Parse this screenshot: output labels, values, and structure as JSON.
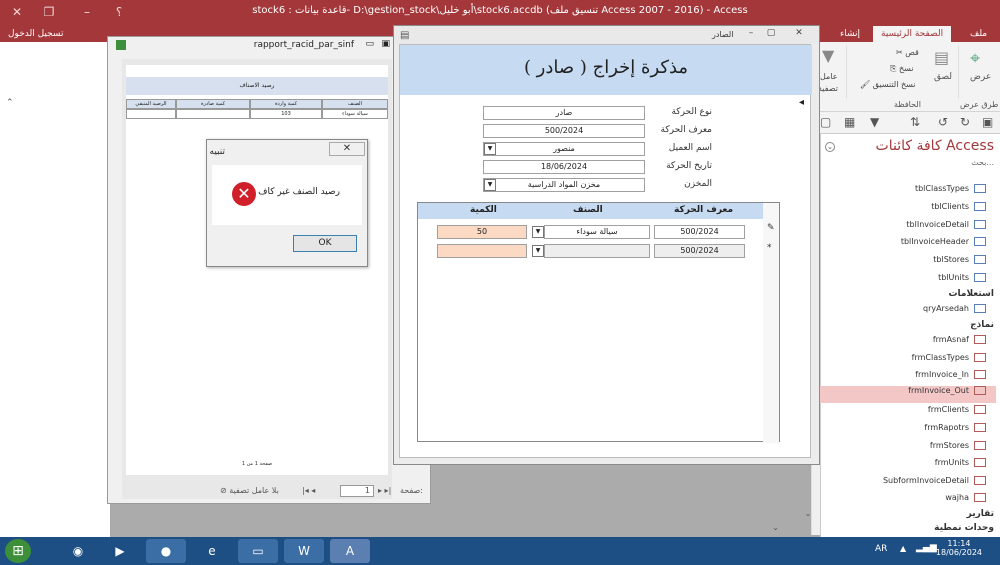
{
  "app": {
    "title": "stock6 : قاعدة بيانات- D:\\gestion_stock\\أبو خليل\\stock6.accdb (تنسيق ملف Access 2007 - 2016) - Access",
    "signin": "تسجيل الدخول",
    "help": "؟"
  },
  "ribbon": {
    "tabs": [
      "ملف",
      "الصفحة الرئيسية",
      "إنشاء"
    ],
    "groups": {
      "views": {
        "label": "طرق عرض",
        "button": "عرض"
      },
      "clipboard": {
        "label": "الحافظة",
        "paste": "لصق",
        "cut": "قص",
        "copy": "نسخ",
        "format_painter": "نسخ التنسيق"
      },
      "filter": {
        "lines": [
          "عامل",
          "تصفية"
        ]
      }
    }
  },
  "nav": {
    "title": "كافة كائنات Access",
    "search": "بحث...",
    "tables": [
      "tblClassTypes",
      "tblClients",
      "tblInvoiceDetail",
      "tblInvoiceHeader",
      "tblStores",
      "tblUnits"
    ],
    "queries_label": "استعلامات",
    "queries": [
      "qryArsedah"
    ],
    "forms_label": "نماذج",
    "forms": [
      "frmAsnaf",
      "frmClassTypes",
      "frmInvoice_In",
      "frmInvoice_Out",
      "frmClients",
      "frmRapotrs",
      "frmStores",
      "frmUnits",
      "SubformInvoiceDetail",
      "wajha"
    ],
    "selected": "frmInvoice_Out",
    "reports_label": "تقارير",
    "modules_label": "وحدات نمطية"
  },
  "report": {
    "title": "rapport_racid_par_sinf",
    "heading": "رصيد الاصناف",
    "columns": [
      "الصنف",
      "كمية واردة",
      "كمية صادرة",
      "الرصيد المتبقي"
    ],
    "rows": [
      [
        "سيالة سوداء",
        "103",
        "",
        ""
      ]
    ],
    "footer": "صفحة 1 من 1",
    "recnav": {
      "page_label": "صفحة:",
      "page_value": "1",
      "filter": "بلا عامل تصفية"
    }
  },
  "alert": {
    "title": "تنبيه",
    "message": "رصيد الصنف غير كاف",
    "ok": "OK"
  },
  "form": {
    "window_title": "الصادر",
    "header": "مذكرة إخراج ( صادر )",
    "fields": [
      {
        "label": "نوع الحركة",
        "value": "صادر",
        "dropdown": false
      },
      {
        "label": "معرف الحركة",
        "value": "500/2024",
        "dropdown": false
      },
      {
        "label": "اسم العميل",
        "value": "منصور",
        "dropdown": true
      },
      {
        "label": "تاريخ الحركة",
        "value": "18/06/2024",
        "dropdown": false
      },
      {
        "label": "المخزن",
        "value": "مخزن المواد الدراسية",
        "dropdown": true
      }
    ],
    "subform": {
      "columns": [
        "معرف الحركة",
        "الصنف",
        "الكمية"
      ],
      "rows": [
        {
          "id": "500/2024",
          "item": "سيالة سوداء",
          "qty": "50"
        },
        {
          "id": "500/2024",
          "item": "",
          "qty": ""
        }
      ]
    }
  },
  "taskbar": {
    "lang": "AR",
    "time": "11:14",
    "date": "18/06/2024"
  },
  "colors": {
    "accent": "#a4373a",
    "form_header": "#c6daf2",
    "selected_nav": "#f4c7c7",
    "qty_cell": "#fbd9c2"
  }
}
